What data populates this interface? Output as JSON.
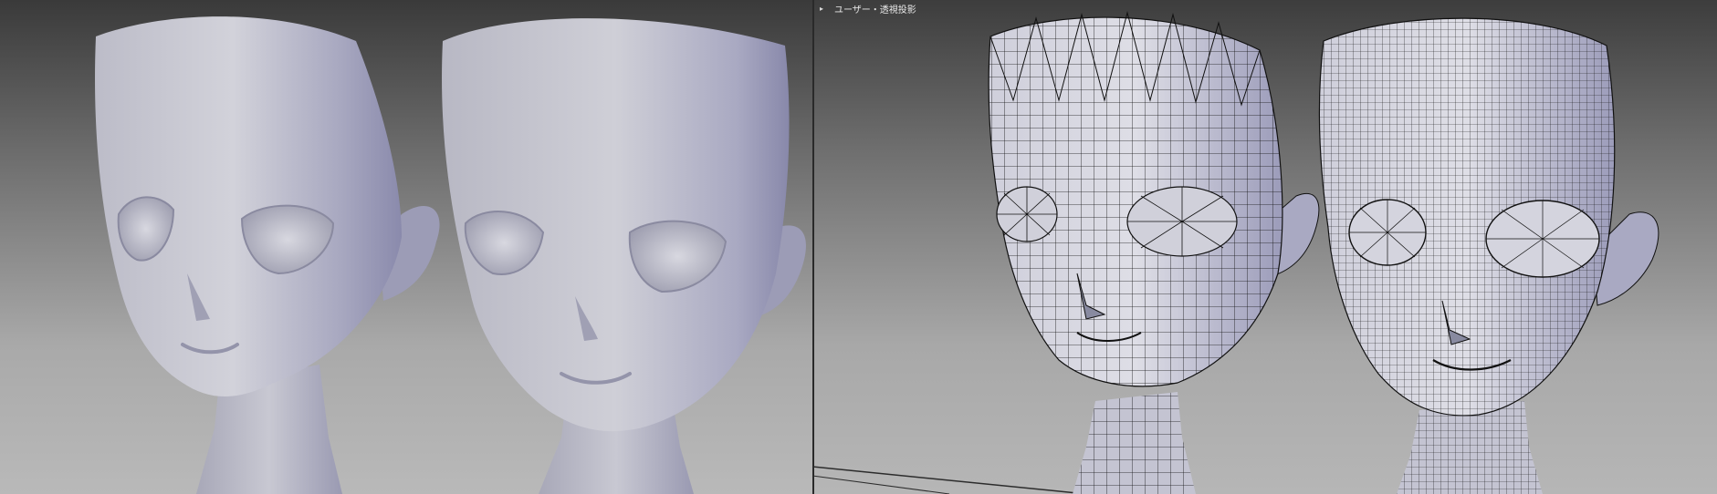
{
  "viewports": {
    "left": {
      "name": "solid-preview"
    },
    "right": {
      "name": "wireframe-preview",
      "title": "ユーザー・透視投影"
    }
  },
  "colors": {
    "mesh_light": "#c9c9d6",
    "mesh_shadow": "#8e8ea8",
    "wire": "#111111",
    "bg_top": "#3a3a3a",
    "bg_bottom": "#b9b9b9"
  },
  "icons": [
    "viewport-menu-icon"
  ]
}
